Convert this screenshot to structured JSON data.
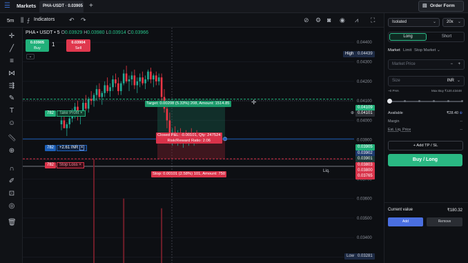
{
  "topbar": {
    "markets": "Markets",
    "tab": "PHA-USDT · 0.03905",
    "order_form": "Order Form"
  },
  "toolbar": {
    "timeframe": "5m",
    "indicators": "Indicators"
  },
  "chart": {
    "symbol": "PHA • USDT • 5",
    "ohlc": {
      "o_label": "O",
      "o": "0.03929",
      "h_label": "H",
      "h": "0.03980",
      "l_label": "L",
      "l": "0.03914",
      "c_label": "C",
      "c": "0.03966"
    },
    "buy_price": "0.03905",
    "buy_label": "Buy",
    "sell_price": "0.03904",
    "sell_label": "Sell",
    "qty": "1",
    "price_axis": [
      "0.04400",
      "0.04300",
      "0.04200",
      "0.04100",
      "0.04000",
      "0.03900",
      "0.03800",
      "0.03700",
      "0.03600",
      "0.03500",
      "0.03400",
      "0.03300"
    ],
    "high_label": "High",
    "high_value": "0.04439",
    "low_label": "Low",
    "low_value": "0.03281",
    "tp_qty": "782",
    "tp_label": "Take Profit",
    "tp_value": "0.04109",
    "tp2_value": "0.04101",
    "pos_qty": "782",
    "pos_pnl": "+2.61 INR",
    "pos_value": "0.03905",
    "pos_mid": "0.03902",
    "pos_low": "0.03901",
    "sl_qty": "782",
    "sl_label": "Stop Loss",
    "sl_value": "0.03803",
    "liq_label": "Liq.",
    "liq_value": "0.03800",
    "liq2_value": "0.03765",
    "target_text": "Target: 0.00208 (5.33%) 208, Amount: 1514.85",
    "closed_pnl_text": "Closed P&L: -0.00101, Qty: 247524",
    "rr_text": "Risk/Reward Ratio: 2.06",
    "stop_text": "Stop: 0.00101 (2.58%) 101, Amount: 750",
    "colors": {
      "up": "#22ab94",
      "down": "#f23645",
      "tp": "#21b07a",
      "sl": "#d9334a",
      "pos": "#1c5fb8"
    }
  },
  "chart_data": {
    "type": "candlestick",
    "ylim": [
      0.0327,
      0.04475
    ],
    "y_ticks": [
      0.044,
      0.043,
      0.042,
      0.041,
      0.04,
      0.039,
      0.038,
      0.037,
      0.036,
      0.035,
      0.034,
      0.033
    ],
    "candles": [
      [
        0.0398,
        0.0402,
        0.0395,
        0.04
      ],
      [
        0.04,
        0.0404,
        0.0398,
        0.0396
      ],
      [
        0.0396,
        0.0399,
        0.0392,
        0.0398
      ],
      [
        0.0398,
        0.0403,
        0.0396,
        0.0401
      ],
      [
        0.0401,
        0.0406,
        0.0399,
        0.0404
      ],
      [
        0.0404,
        0.0409,
        0.0401,
        0.0407
      ],
      [
        0.0407,
        0.041,
        0.04,
        0.0402
      ],
      [
        0.0402,
        0.0405,
        0.0398,
        0.0404
      ],
      [
        0.0404,
        0.0411,
        0.0403,
        0.0409
      ],
      [
        0.0409,
        0.0413,
        0.0405,
        0.0406
      ],
      [
        0.0406,
        0.0412,
        0.0404,
        0.0411
      ],
      [
        0.0411,
        0.0415,
        0.0408,
        0.041
      ],
      [
        0.041,
        0.0414,
        0.0407,
        0.0413
      ],
      [
        0.0413,
        0.0418,
        0.041,
        0.0416
      ],
      [
        0.0416,
        0.0419,
        0.0411,
        0.0412
      ],
      [
        0.0412,
        0.0415,
        0.0408,
        0.0414
      ],
      [
        0.0414,
        0.042,
        0.0412,
        0.0418
      ],
      [
        0.0418,
        0.0422,
        0.0414,
        0.0415
      ],
      [
        0.0415,
        0.0419,
        0.0412,
        0.0417
      ],
      [
        0.0417,
        0.0423,
        0.0415,
        0.0421
      ],
      [
        0.0421,
        0.0424,
        0.0417,
        0.0419
      ],
      [
        0.0419,
        0.0422,
        0.0413,
        0.0415
      ],
      [
        0.0415,
        0.042,
        0.0413,
        0.0419
      ],
      [
        0.0419,
        0.0426,
        0.0418,
        0.0424
      ],
      [
        0.0424,
        0.0428,
        0.0419,
        0.042
      ],
      [
        0.042,
        0.0423,
        0.0415,
        0.0421
      ],
      [
        0.0421,
        0.0425,
        0.0418,
        0.0423
      ],
      [
        0.0423,
        0.0426,
        0.0416,
        0.0418
      ],
      [
        0.0418,
        0.0422,
        0.0414,
        0.042
      ],
      [
        0.042,
        0.0424,
        0.0417,
        0.0422
      ],
      [
        0.0422,
        0.0425,
        0.0418,
        0.0419
      ],
      [
        0.0419,
        0.0423,
        0.0416,
        0.0421
      ],
      [
        0.0421,
        0.0426,
        0.042,
        0.0425
      ],
      [
        0.0425,
        0.0427,
        0.0419,
        0.0421
      ],
      [
        0.0421,
        0.0424,
        0.0417,
        0.0423
      ],
      [
        0.0423,
        0.0425,
        0.0418,
        0.042
      ],
      [
        0.042,
        0.0424,
        0.0418,
        0.0422
      ],
      [
        0.0422,
        0.0424,
        0.041,
        0.0412
      ],
      [
        0.0412,
        0.0416,
        0.0404,
        0.0406
      ],
      [
        0.0406,
        0.041,
        0.0396,
        0.04
      ],
      [
        0.04,
        0.0404,
        0.0388,
        0.0391
      ],
      [
        0.0391,
        0.0396,
        0.0387,
        0.0394
      ],
      [
        0.0394,
        0.0397,
        0.0388,
        0.039
      ],
      [
        0.039,
        0.0395,
        0.0387,
        0.0393
      ],
      [
        0.0393,
        0.0396,
        0.0388,
        0.0389
      ],
      [
        0.0389,
        0.0394,
        0.0386,
        0.0392
      ],
      [
        0.0392,
        0.0395,
        0.0388,
        0.039
      ],
      [
        0.039,
        0.0394,
        0.0387,
        0.0393
      ],
      [
        0.0393,
        0.0396,
        0.0389,
        0.0391
      ],
      [
        0.0391,
        0.0394,
        0.0387,
        0.0392
      ],
      [
        0.0392,
        0.0395,
        0.0388,
        0.039
      ]
    ],
    "volume_spikes": [
      [
        12,
        0.038
      ],
      [
        23,
        0.036
      ],
      [
        37,
        0.0355
      ]
    ]
  },
  "panel": {
    "margin_mode": "Isolated",
    "leverage": "20x",
    "long": "Long",
    "short": "Short",
    "market": "Market",
    "limit": "Limit",
    "stop_market": "Stop Market",
    "market_price_placeholder": "Market Price",
    "size_placeholder": "Size",
    "size_currency": "INR",
    "size_hint": "~0 PHA",
    "max_buy": "Max Buy ₹120.43448",
    "available_label": "Available",
    "available_value": "₹28.40",
    "margin_label": "Margin",
    "margin_value": "--",
    "liq_label": "Est. Liq. Price",
    "liq_value": "--",
    "add_tpsl": "+ Add TP / SL",
    "buy_long": "Buy / Long",
    "current_value_label": "Current value",
    "current_value": "₹180.32",
    "add": "Add",
    "remove": "Remove"
  }
}
